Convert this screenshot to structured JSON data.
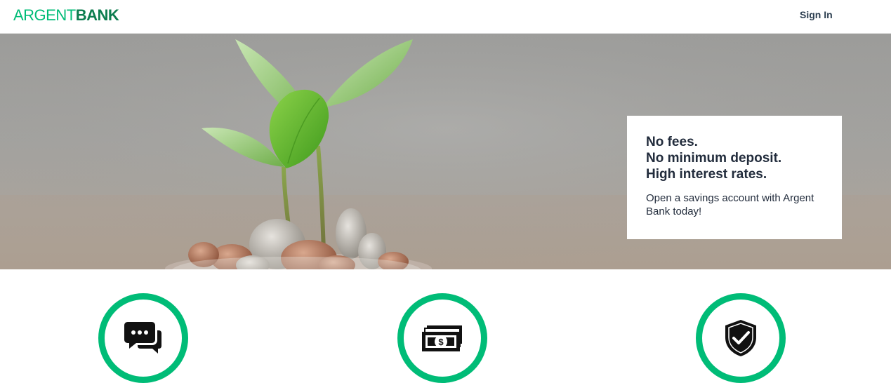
{
  "brand": {
    "name_part1": "ARGENT",
    "name_part2": "BANK",
    "accent_color": "#00bc77",
    "dark_color": "#0c7d4f"
  },
  "nav": {
    "signin_label": "Sign In"
  },
  "hero": {
    "subtitles": [
      "No fees.",
      "No minimum deposit.",
      "High interest rates."
    ],
    "text": "Open a savings account with Argent Bank today!"
  },
  "features": [
    {
      "icon": "chat-icon"
    },
    {
      "icon": "money-icon"
    },
    {
      "icon": "security-icon"
    }
  ]
}
